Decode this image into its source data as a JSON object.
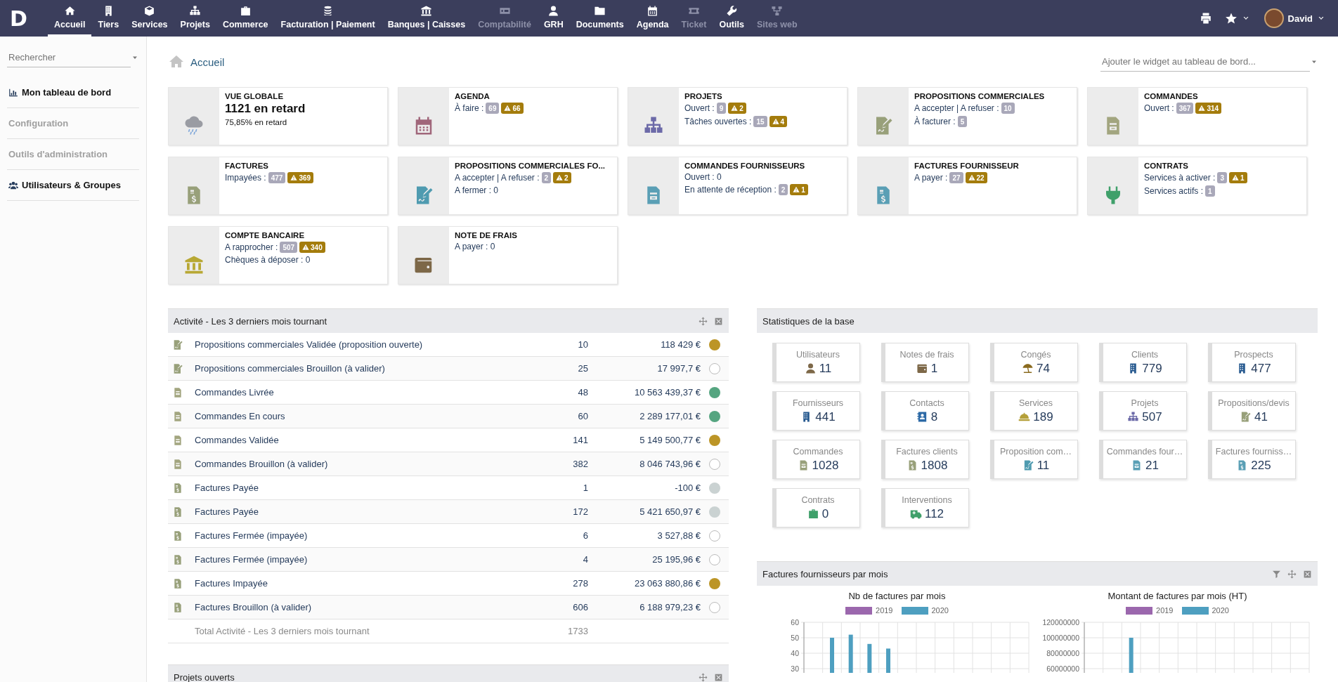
{
  "topbar": {
    "logo": "D",
    "nav": [
      {
        "label": "Accueil",
        "selected": true,
        "disabled": false
      },
      {
        "label": "Tiers",
        "selected": false,
        "disabled": false
      },
      {
        "label": "Services",
        "selected": false,
        "disabled": false
      },
      {
        "label": "Projets",
        "selected": false,
        "disabled": false
      },
      {
        "label": "Commerce",
        "selected": false,
        "disabled": false
      },
      {
        "label": "Facturation | Paiement",
        "selected": false,
        "disabled": false
      },
      {
        "label": "Banques | Caisses",
        "selected": false,
        "disabled": false
      },
      {
        "label": "Comptabilité",
        "selected": false,
        "disabled": true
      },
      {
        "label": "GRH",
        "selected": false,
        "disabled": false
      },
      {
        "label": "Documents",
        "selected": false,
        "disabled": false
      },
      {
        "label": "Agenda",
        "selected": false,
        "disabled": false
      },
      {
        "label": "Ticket",
        "selected": false,
        "disabled": true
      },
      {
        "label": "Outils",
        "selected": false,
        "disabled": false
      },
      {
        "label": "Sites web",
        "selected": false,
        "disabled": true
      }
    ],
    "user": "David"
  },
  "sidebar": {
    "search": {
      "placeholder": "Rechercher"
    },
    "items": [
      {
        "label": "Mon tableau de bord",
        "disabled": false,
        "kind": "chart"
      },
      {
        "label": "Configuration",
        "disabled": true,
        "kind": "plain"
      },
      {
        "label": "Outils d'administration",
        "disabled": true,
        "kind": "plain"
      },
      {
        "label": "Utilisateurs & Groupes",
        "disabled": false,
        "kind": "users"
      }
    ]
  },
  "breadcrumb": "Accueil",
  "widget_select": {
    "placeholder": "Ajouter le widget au tableau de bord..."
  },
  "cards": [
    {
      "kind": "summary",
      "title": "VUE GLOBALE",
      "big": "1121 en retard",
      "sub": "75,85% en retard"
    },
    {
      "kind": "counters",
      "title": "AGENDA",
      "lines": [
        {
          "text": "À faire :",
          "badges": [
            {
              "kind": "count",
              "text": "69"
            },
            {
              "kind": "late",
              "text": "66"
            }
          ]
        }
      ]
    },
    {
      "kind": "counters",
      "title": "PROJETS",
      "lines": [
        {
          "text": "Ouvert :",
          "badges": [
            {
              "kind": "count",
              "text": "9"
            },
            {
              "kind": "late",
              "text": "2"
            }
          ]
        },
        {
          "text": "Tâches ouvertes :",
          "badges": [
            {
              "kind": "count",
              "text": "15"
            },
            {
              "kind": "late",
              "text": "4"
            }
          ]
        }
      ]
    },
    {
      "kind": "counters",
      "title": "PROPOSITIONS COMMERCIALES",
      "lines": [
        {
          "text": "A accepter | A refuser :",
          "badges": [
            {
              "kind": "count",
              "text": "10"
            }
          ]
        },
        {
          "text": "À facturer :",
          "badges": [
            {
              "kind": "count",
              "text": "5"
            }
          ]
        }
      ]
    },
    {
      "kind": "counters",
      "title": "COMMANDES",
      "lines": [
        {
          "text": "Ouvert :",
          "badges": [
            {
              "kind": "count",
              "text": "367"
            },
            {
              "kind": "late",
              "text": "314"
            }
          ]
        }
      ]
    },
    {
      "kind": "counters",
      "title": "FACTURES",
      "lines": [
        {
          "text": "Impayées :",
          "badges": [
            {
              "kind": "count",
              "text": "477"
            },
            {
              "kind": "late",
              "text": "369"
            }
          ]
        }
      ]
    },
    {
      "kind": "counters",
      "title": "PROPOSITIONS COMMERCIALES FO...",
      "lines": [
        {
          "text": "A accepter | A refuser :",
          "badges": [
            {
              "kind": "count",
              "text": "2"
            },
            {
              "kind": "late",
              "text": "2"
            }
          ]
        },
        {
          "text": "A fermer : 0"
        }
      ]
    },
    {
      "kind": "counters",
      "title": "COMMANDES FOURNISSEURS",
      "lines": [
        {
          "text": "Ouvert : 0"
        },
        {
          "text": "En attente de réception :",
          "badges": [
            {
              "kind": "count",
              "text": "2"
            },
            {
              "kind": "late",
              "text": "1"
            }
          ]
        }
      ]
    },
    {
      "kind": "counters",
      "title": "FACTURES FOURNISSEUR",
      "lines": [
        {
          "text": "A payer :",
          "badges": [
            {
              "kind": "count",
              "text": "27"
            },
            {
              "kind": "late",
              "text": "22"
            }
          ]
        }
      ]
    },
    {
      "kind": "counters",
      "title": "CONTRATS",
      "lines": [
        {
          "text": "Services à activer :",
          "badges": [
            {
              "kind": "count",
              "text": "3"
            },
            {
              "kind": "late",
              "text": "1"
            }
          ]
        },
        {
          "text": "Services actifs :",
          "badges": [
            {
              "kind": "count",
              "text": "1"
            }
          ]
        }
      ]
    },
    {
      "kind": "counters",
      "title": "COMPTE BANCAIRE",
      "lines": [
        {
          "text": "A rapprocher :",
          "badges": [
            {
              "kind": "count",
              "text": "507"
            },
            {
              "kind": "late",
              "text": "340"
            }
          ]
        },
        {
          "text": "Chèques à déposer : 0"
        }
      ]
    },
    {
      "kind": "counters",
      "title": "NOTE DE FRAIS",
      "lines": [
        {
          "text": "A payer : 0"
        }
      ]
    }
  ],
  "activity": {
    "title": "Activité - Les 3 derniers mois tournant",
    "rows": [
      {
        "kind": "proposal",
        "label": "Propositions commerciales Validée (proposition ouverte)",
        "count": "10",
        "amount": "118 429 €",
        "filled": true,
        "color": "#bc9526"
      },
      {
        "kind": "proposal",
        "label": "Propositions commerciales Brouillon (à valider)",
        "count": "25",
        "amount": "17 997,7 €",
        "filled": false
      },
      {
        "kind": "order",
        "label": "Commandes Livrée",
        "count": "48",
        "amount": "10 563 439,37 €",
        "filled": true,
        "color": "#55a580"
      },
      {
        "kind": "order",
        "label": "Commandes En cours",
        "count": "60",
        "amount": "2 289 177,01 €",
        "filled": true,
        "color": "#55a580"
      },
      {
        "kind": "order",
        "label": "Commandes Validée",
        "count": "141",
        "amount": "5 149 500,77 €",
        "filled": true,
        "color": "#bc9526"
      },
      {
        "kind": "order",
        "label": "Commandes Brouillon (à valider)",
        "count": "382",
        "amount": "8 046 743,96 €",
        "filled": false
      },
      {
        "kind": "invoice",
        "label": "Factures Payée",
        "count": "1",
        "amount": "-100 €",
        "filled": true,
        "color": "#cad2d2"
      },
      {
        "kind": "invoice",
        "label": "Factures Payée",
        "count": "172",
        "amount": "5 421 650,97 €",
        "filled": true,
        "color": "#cad2d2"
      },
      {
        "kind": "invoice",
        "label": "Factures Fermée (impayée)",
        "count": "6",
        "amount": "3 527,88 €",
        "filled": false
      },
      {
        "kind": "invoice",
        "label": "Factures Fermée (impayée)",
        "count": "4",
        "amount": "25 195,96 €",
        "filled": false
      },
      {
        "kind": "invoice",
        "label": "Factures Impayée",
        "count": "278",
        "amount": "23 063 880,86 €",
        "filled": true,
        "color": "#bc9526"
      },
      {
        "kind": "invoice",
        "label": "Factures Brouillon (à valider)",
        "count": "606",
        "amount": "6 188 979,23 €",
        "filled": false
      }
    ],
    "total": {
      "label": "Total Activité - Les 3 derniers mois tournant",
      "count": "1733"
    }
  },
  "projects_panel": {
    "title": "Projets ouverts"
  },
  "stats": {
    "title": "Statistiques de la base",
    "items": [
      {
        "label": "Utilisateurs",
        "value": "11"
      },
      {
        "label": "Notes de frais",
        "value": "1"
      },
      {
        "label": "Congés",
        "value": "74"
      },
      {
        "label": "Clients",
        "value": "779"
      },
      {
        "label": "Prospects",
        "value": "477"
      },
      {
        "label": "Fournisseurs",
        "value": "441"
      },
      {
        "label": "Contacts",
        "value": "8"
      },
      {
        "label": "Services",
        "value": "189"
      },
      {
        "label": "Projets",
        "value": "507"
      },
      {
        "label": "Propositions/devis",
        "value": "41"
      },
      {
        "label": "Commandes",
        "value": "1028"
      },
      {
        "label": "Factures clients",
        "value": "1808"
      },
      {
        "label": "Proposition com…",
        "value": "11"
      },
      {
        "label": "Commandes four…",
        "value": "21"
      },
      {
        "label": "Factures fourniss…",
        "value": "225"
      },
      {
        "label": "Contrats",
        "value": "0"
      },
      {
        "label": "Interventions",
        "value": "112"
      }
    ]
  },
  "invoices_panel": {
    "title": "Factures fournisseurs par mois",
    "charts": [
      {
        "chart_data": {
          "type": "bar",
          "title": "Nb de factures par mois",
          "grid": true,
          "ylim": [
            0,
            60
          ],
          "yticks": [
            30,
            40,
            50,
            60
          ],
          "series": [
            {
              "name": "2019",
              "color": "#9b67ad",
              "values": [
                null,
                null,
                null,
                null,
                null,
                null,
                null,
                null,
                null,
                null,
                null,
                null
              ]
            },
            {
              "name": "2020",
              "color": "#4e9fc0",
              "values": [
                null,
                50,
                52,
                46,
                43,
                null,
                null,
                null,
                null,
                null,
                null,
                null
              ]
            }
          ]
        }
      },
      {
        "chart_data": {
          "type": "bar",
          "title": "Montant de factures par mois (HT)",
          "grid": true,
          "ylim": [
            0,
            120000000
          ],
          "yticks": [
            60000000,
            80000000,
            100000000,
            120000000
          ],
          "series": [
            {
              "name": "2019",
              "color": "#9b67ad",
              "values": [
                null,
                null,
                null,
                null,
                null,
                null,
                null,
                null,
                null,
                null,
                null,
                null
              ]
            },
            {
              "name": "2020",
              "color": "#4e9fc0",
              "values": [
                null,
                null,
                100000000,
                null,
                null,
                null,
                null,
                null,
                null,
                null,
                null,
                null
              ]
            }
          ]
        }
      }
    ]
  }
}
